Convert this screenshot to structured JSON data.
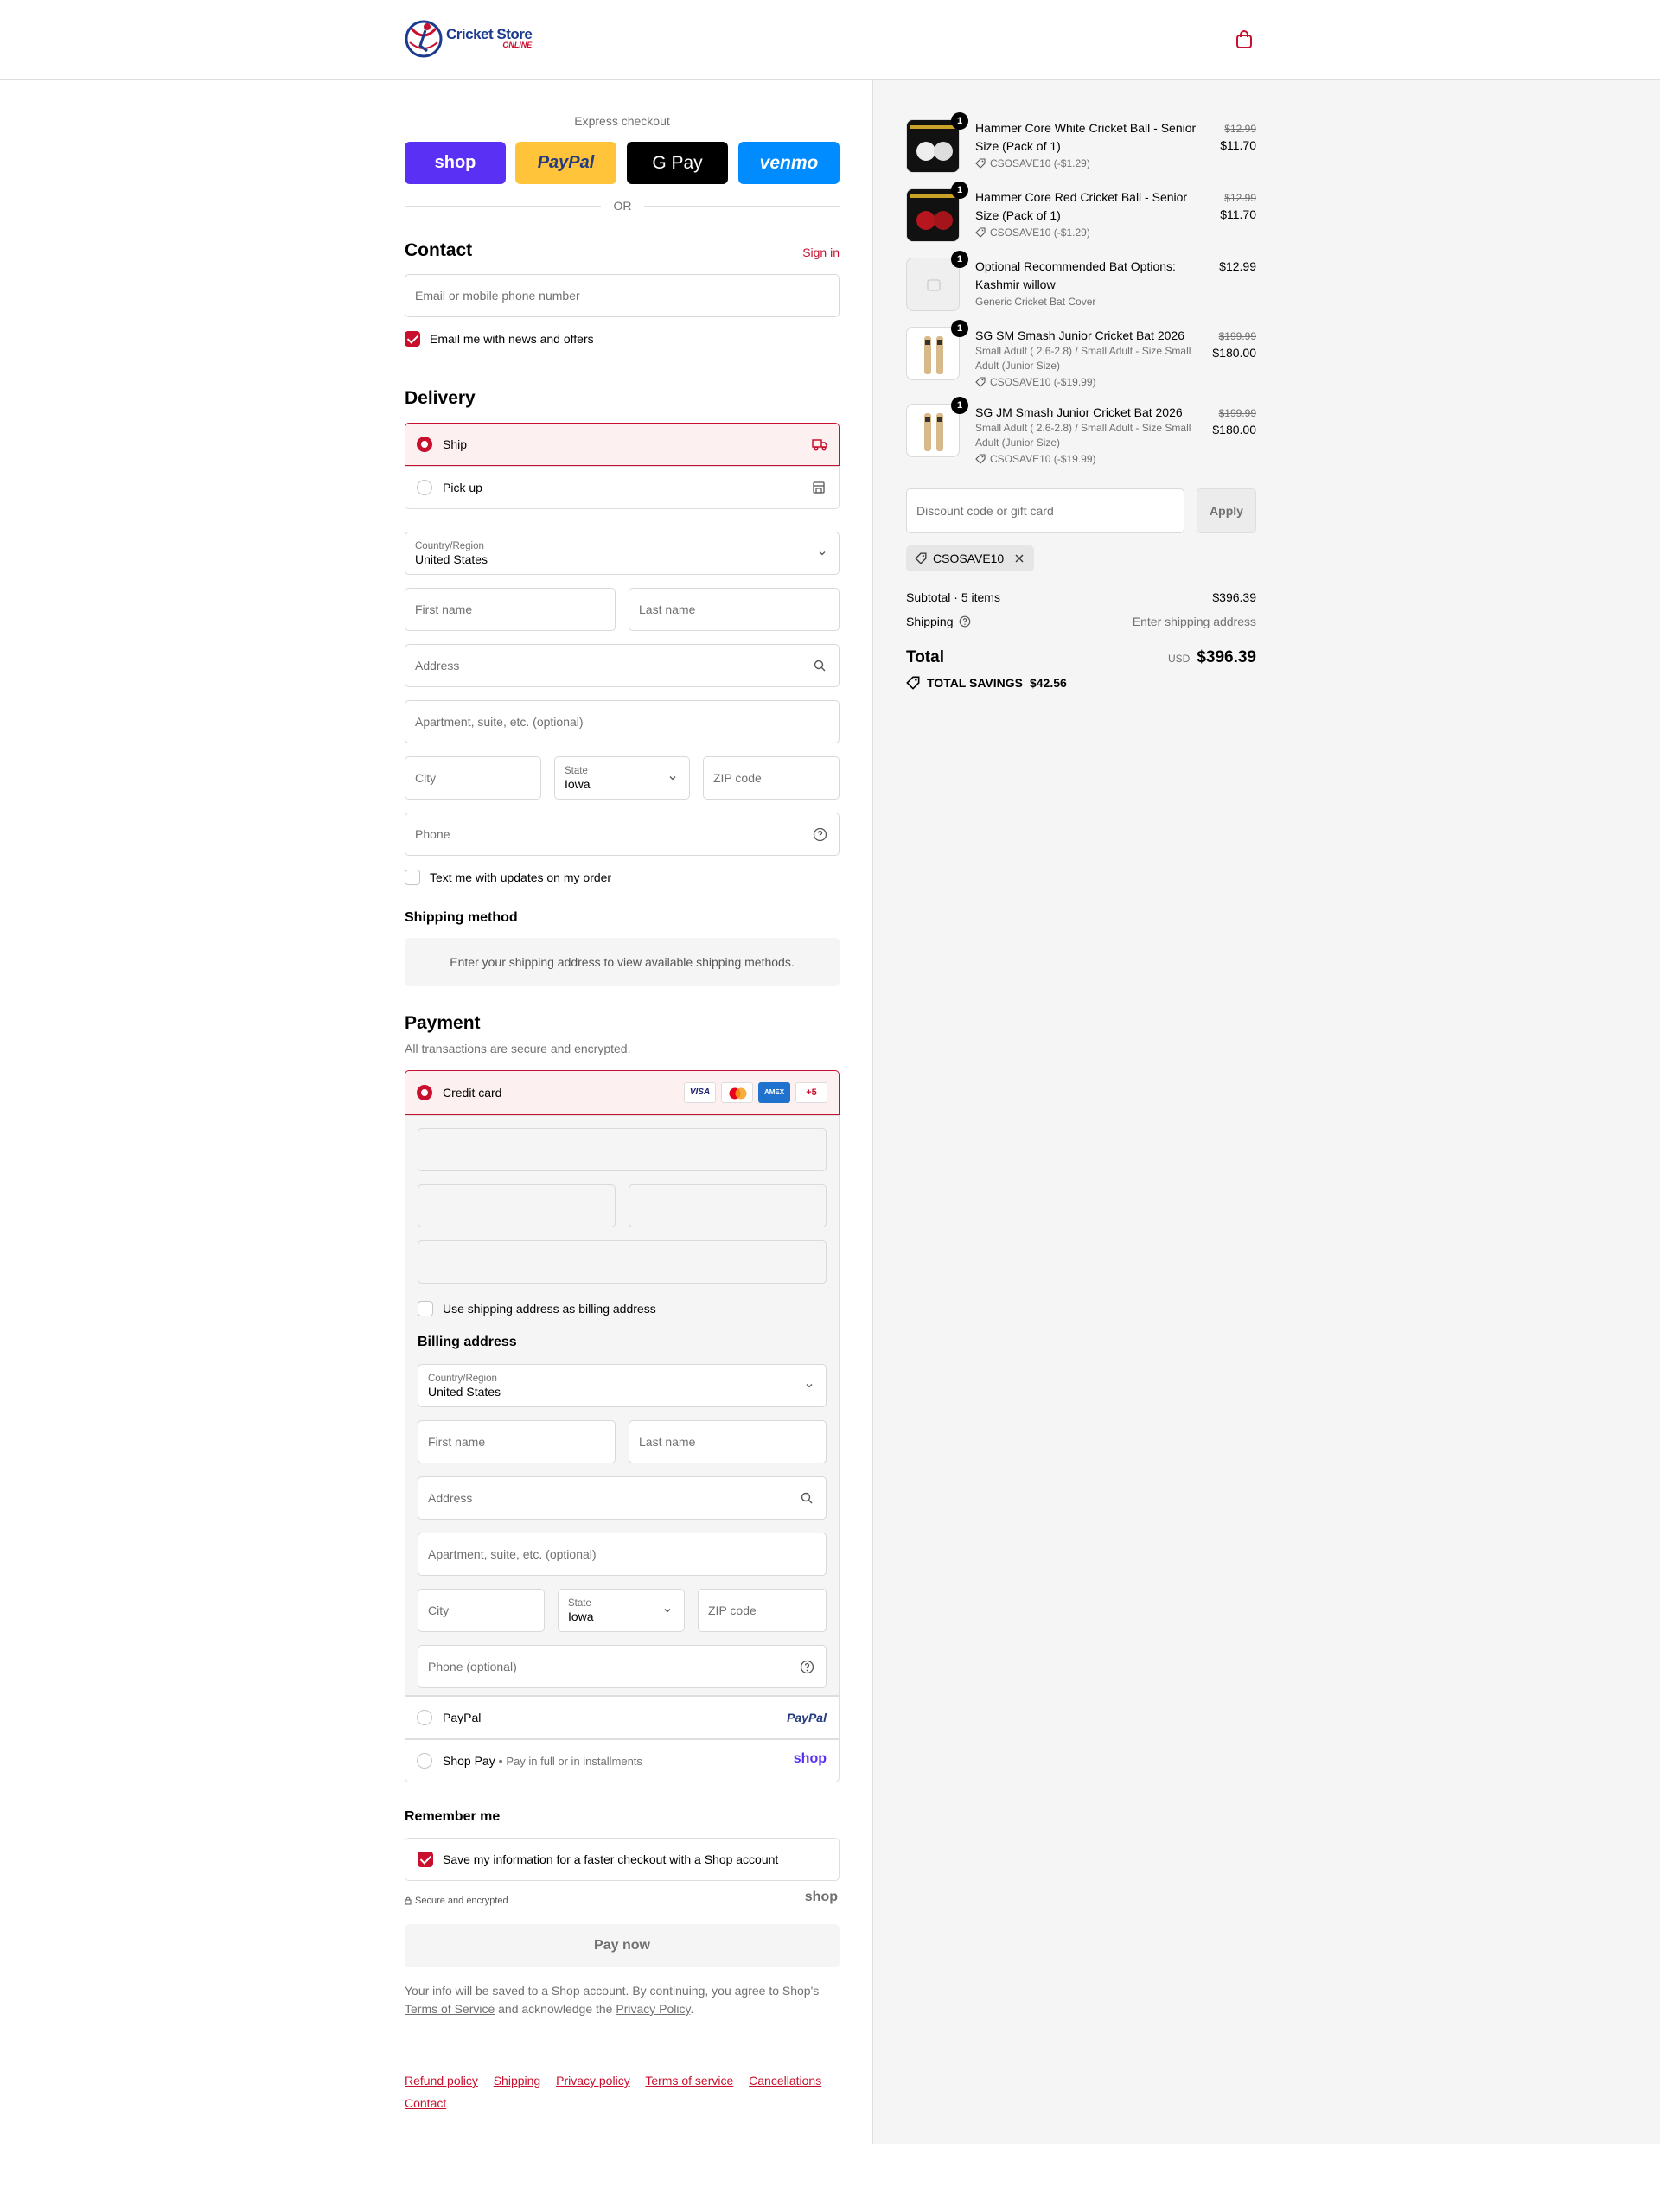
{
  "header": {
    "logo_main": "Cricket Store",
    "logo_sub": "ONLINE",
    "cart_icon": "shopping-bag-icon"
  },
  "express": {
    "label": "Express checkout",
    "buttons": [
      {
        "label": "shop",
        "color": "#5a31f4"
      },
      {
        "label": "PayPal",
        "color": "#ffc439"
      },
      {
        "label": "G Pay",
        "color": "#000000"
      },
      {
        "label": "venmo",
        "color": "#008cff"
      }
    ],
    "or": "OR"
  },
  "contact": {
    "title": "Contact",
    "sign_in": "Sign in",
    "email_placeholder": "Email or mobile phone number",
    "news_label": "Email me with news and offers"
  },
  "delivery": {
    "title": "Delivery",
    "ship": "Ship",
    "pickup": "Pick up",
    "country_label": "Country/Region",
    "country_value": "United States",
    "first_name": "First name",
    "last_name": "Last name",
    "address": "Address",
    "apartment": "Apartment, suite, etc. (optional)",
    "city": "City",
    "state_label": "State",
    "state_value": "Iowa",
    "zip": "ZIP code",
    "phone": "Phone",
    "text_updates": "Text me with updates on my order"
  },
  "shipping_method": {
    "title": "Shipping method",
    "message": "Enter your shipping address to view available shipping methods."
  },
  "payment": {
    "title": "Payment",
    "subtitle": "All transactions are secure and encrypted.",
    "credit_card": "Credit card",
    "card_brands": [
      "VISA",
      "MC",
      "AMEX"
    ],
    "more_brands": "+5",
    "use_shipping": "Use shipping address as billing address",
    "billing_title": "Billing address",
    "billing": {
      "country_label": "Country/Region",
      "country_value": "United States",
      "first_name": "First name",
      "last_name": "Last name",
      "address": "Address",
      "apartment": "Apartment, suite, etc. (optional)",
      "city": "City",
      "state_label": "State",
      "state_value": "Iowa",
      "zip": "ZIP code",
      "phone": "Phone (optional)"
    },
    "paypal": "PayPal",
    "paypal_logo": "PayPal",
    "shop_pay": "Shop Pay",
    "shop_pay_sub": "Pay in full or in installments",
    "shop_logo": "shop"
  },
  "remember": {
    "title": "Remember me",
    "save_label": "Save my information for a faster checkout with a Shop account",
    "secure": "Secure and encrypted",
    "shop_logo": "shop"
  },
  "pay_now": "Pay now",
  "legal": {
    "text1": "Your info will be saved to a Shop account. By continuing, you agree to Shop's",
    "terms": "Terms of Service",
    "text2": "and acknowledge the",
    "privacy": "Privacy Policy",
    "text3": "."
  },
  "footer": {
    "links": [
      "Refund policy",
      "Shipping",
      "Privacy policy",
      "Terms of service",
      "Cancellations",
      "Contact"
    ]
  },
  "order": {
    "items": [
      {
        "qty": "1",
        "title": "Hammer Core White Cricket Ball - Senior Size (Pack of 1)",
        "variant": "",
        "discount": "CSOSAVE10 (-$1.29)",
        "old_price": "$12.99",
        "price": "$11.70"
      },
      {
        "qty": "1",
        "title": "Hammer Core Red Cricket Ball - Senior Size (Pack of 1)",
        "variant": "",
        "discount": "CSOSAVE10 (-$1.29)",
        "old_price": "$12.99",
        "price": "$11.70"
      },
      {
        "qty": "1",
        "title": "Optional Recommended Bat Options: Kashmir willow",
        "variant": "Generic Cricket Bat Cover",
        "discount": "",
        "old_price": "",
        "price": "$12.99"
      },
      {
        "qty": "1",
        "title": "SG SM Smash Junior Cricket Bat 2026",
        "variant": "Small Adult ( 2.6-2.8) / Small Adult - Size Small Adult (Junior Size)",
        "discount": "CSOSAVE10 (-$19.99)",
        "old_price": "$199.99",
        "price": "$180.00"
      },
      {
        "qty": "1",
        "title": "SG JM Smash Junior Cricket Bat 2026",
        "variant": "Small Adult ( 2.6-2.8) / Small Adult - Size Small Adult (Junior Size)",
        "discount": "CSOSAVE10 (-$19.99)",
        "old_price": "$199.99",
        "price": "$180.00"
      }
    ],
    "discount_placeholder": "Discount code or gift card",
    "apply": "Apply",
    "applied_code": "CSOSAVE10",
    "subtotal_label": "Subtotal · 5 items",
    "subtotal_value": "$396.39",
    "shipping_label": "Shipping",
    "shipping_value": "Enter shipping address",
    "total_label": "Total",
    "currency": "USD",
    "total_value": "$396.39",
    "savings_label": "TOTAL SAVINGS",
    "savings_value": "$42.56"
  },
  "colors": {
    "accent": "#c8102e",
    "border": "#dedede",
    "sidebar_bg": "#f5f5f5"
  }
}
